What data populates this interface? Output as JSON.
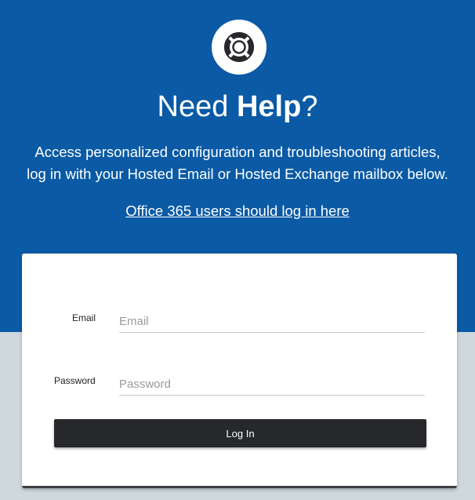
{
  "hero": {
    "logo_icon": "lifebuoy-icon",
    "headline_light": "Need",
    "headline_bold": "Help",
    "headline_mark": "?",
    "subtitle_line1": "Access personalized configuration and troubleshooting articles,",
    "subtitle_line2": "log in with your Hosted Email or Hosted Exchange mailbox below.",
    "office365_link": "Office 365 users should log in here"
  },
  "form": {
    "email_label": "Email",
    "email_placeholder": "Email",
    "email_value": "",
    "password_label": "Password",
    "password_placeholder": "Password",
    "password_value": "",
    "login_button": "Log In"
  },
  "colors": {
    "hero_background": "#0a5aa5",
    "page_background": "#cfd8dd",
    "button_background": "#26282c"
  }
}
